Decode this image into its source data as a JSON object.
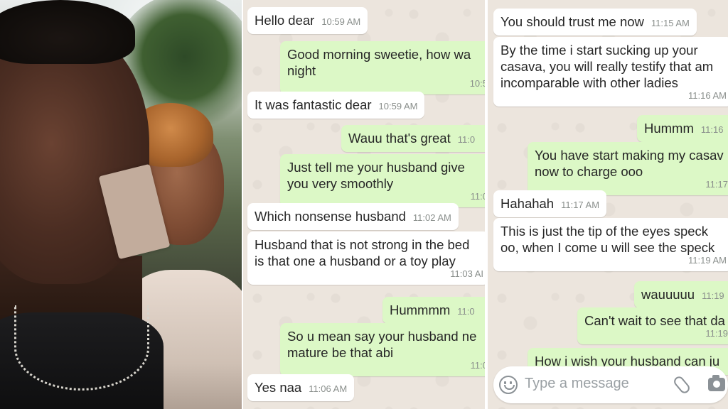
{
  "chat_left": {
    "messages": [
      {
        "type": "in",
        "text": "Hello dear",
        "time": "10:59 AM"
      },
      {
        "type": "out",
        "text": "Good morning sweetie, how wa\nnight",
        "time": "10:5"
      },
      {
        "type": "in",
        "text": "It was fantastic dear",
        "time": "10:59 AM"
      },
      {
        "type": "out",
        "text": "Wauu that's great",
        "time": "11:0"
      },
      {
        "type": "out",
        "text": "Just tell me your husband give\nyou very smoothly",
        "time": "11:0"
      },
      {
        "type": "in",
        "text": "Which nonsense husband",
        "time": "11:02 AM"
      },
      {
        "type": "in",
        "text": "Husband that is not strong in the bed\nis that one a husband or a toy play",
        "time": "11:03 AI"
      },
      {
        "type": "out",
        "text": "Hummmm",
        "time": "11:0"
      },
      {
        "type": "out",
        "text": "So u mean say your husband ne\nmature be that abi",
        "time": "11:0"
      },
      {
        "type": "in",
        "text": "Yes naa",
        "time": "11:06 AM"
      }
    ]
  },
  "chat_right": {
    "messages": [
      {
        "type": "in",
        "text": "You should trust me now",
        "time": "11:15 AM"
      },
      {
        "type": "in",
        "text": "By the time i start sucking up your\ncasava, you will really testify that am\nincomparable with other ladies",
        "time": "11:16 AM"
      },
      {
        "type": "out",
        "text": "Hummm",
        "time": "11:16"
      },
      {
        "type": "out",
        "text": "You have start making my casav\nnow to charge ooo",
        "time": "11:17"
      },
      {
        "type": "in",
        "text": "Hahahah",
        "time": "11:17 AM"
      },
      {
        "type": "in",
        "text": "This is just the tip of the eyes speck\noo, when I come u will see the speck",
        "time": "11:19 AM"
      },
      {
        "type": "out",
        "text": "wauuuuu",
        "time": "11:19"
      },
      {
        "type": "out",
        "text": "Can't wait to see that da",
        "time": "11:19"
      },
      {
        "type": "out",
        "text": "How i wish your husband can ju",
        "time": ""
      }
    ],
    "input_placeholder": "Type a message"
  },
  "icons": [
    "emoji-icon",
    "paperclip-icon",
    "camera-icon"
  ],
  "colors": {
    "incoming": "#ffffff",
    "outgoing": "#dcf8c6",
    "background": "#ece5dd"
  }
}
